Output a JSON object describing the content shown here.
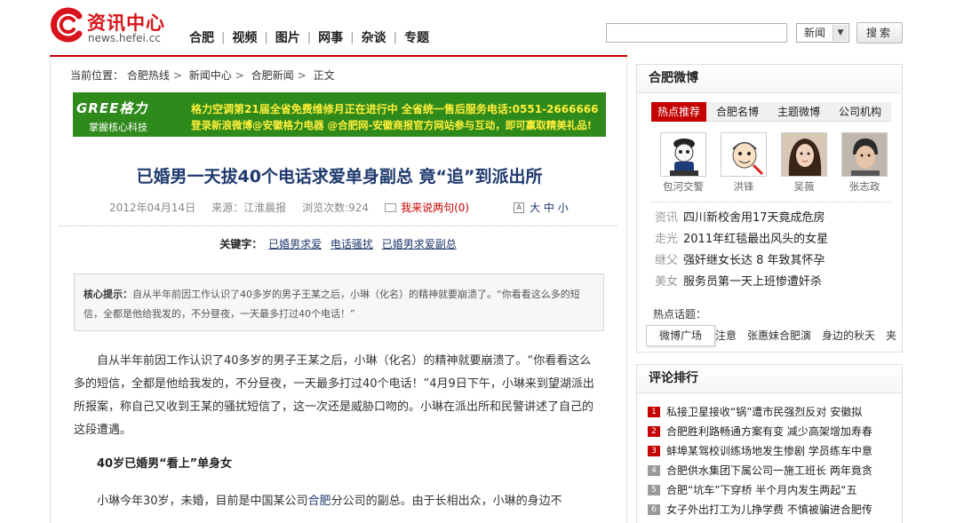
{
  "site": {
    "name": "资讯中心",
    "url": "news.hefei.cc",
    "brand_color": "#d7141b"
  },
  "nav": [
    "合肥",
    "视频",
    "图片",
    "网事",
    "杂谈",
    "专题"
  ],
  "search": {
    "input_value": "",
    "select_value": "新闻",
    "button_label": "搜索"
  },
  "breadcrumb": {
    "label": "当前位置：",
    "items": [
      "合肥热线",
      "新闻中心",
      "合肥新闻",
      "正文"
    ]
  },
  "banner": {
    "brand": "GREE格力",
    "tagline": "掌握核心科技",
    "line1": "格力空调第21届全省免费维修月正在进行中    全省统一售后服务电话:0551-2666666",
    "line2": "登录新浪微博@安徽格力电器 @合肥网-安徽商报官方网站参与互动，即可赢取精美礼品!"
  },
  "article": {
    "title": "已婚男一天拔40个电话求爱单身副总 竟“追”到派出所",
    "date": "2012年04月14日",
    "source": "来源：江淮晨报",
    "views": "浏览次数:924",
    "comment": "我来说两句(0)",
    "font_size_label": "大 中 小",
    "keywords_label": "关键字：",
    "keywords": [
      "已婚男求爱",
      "电话骚扰",
      "已婚男求爱副总"
    ],
    "summary_label": "核心提示：",
    "summary": "自从半年前因工作认识了40多岁的男子王某之后，小琳（化名）的精神就要崩溃了。“你看看这么多的短信，全都是他给我发的，不分昼夜，一天最多打过40个电话！”",
    "para1": "自从半年前因工作认识了40多岁的男子王某之后，小琳（化名）的精神就要崩溃了。“你看看这么多的短信，全都是他给我发的，不分昼夜，一天最多打过40个电话！”4月9日下午，小琳来到望湖派出所报案，称自己又收到王某的骚扰短信了，这一次还是威胁口吻的。小琳在派出所和民警讲述了自己的这段遭遇。",
    "subheading": "40岁已婚男“看上”单身女",
    "para2_before": "小琳今年30岁，未婚，目前是中国某公司",
    "para2_link": "合肥",
    "para2_after": "分公司的副总。由于长相出众，小琳的身边不"
  },
  "weibo": {
    "title": "合肥微博",
    "tabs": [
      "热点推荐",
      "合肥名博",
      "主题微博",
      "公司机构"
    ],
    "active_tab": "热点推荐",
    "avatars": [
      "包河交警",
      "洪锋",
      "吴薇",
      "张志政"
    ],
    "news": [
      {
        "cat": "资讯",
        "text": "四川新校舍用17天竟成危房"
      },
      {
        "cat": "走光",
        "text": "2011年红毯最出风头的女星"
      },
      {
        "cat": "继父",
        "text": "强奸继女长达 8 年致其怀孕"
      },
      {
        "cat": "美女",
        "text": "服务员第一天上班惨遭奸杀"
      }
    ],
    "hot_label": "热点话题：",
    "hot_topics": [
      "注意",
      "张惠妹合肥演",
      "身边的秋天",
      "夹"
    ],
    "square_button": "微博广场"
  },
  "ranking": {
    "title": "评论排行",
    "items": [
      {
        "num": "1",
        "text": "私接卫星接收“锅”遭市民强烈反对 安徽拟"
      },
      {
        "num": "2",
        "text": "合肥胜利路畅通方案有变 减少高架增加寿春"
      },
      {
        "num": "3",
        "text": "蚌埠某驾校训练场地发生惨剧 学员练车中意"
      },
      {
        "num": "4",
        "text": "合肥供水集团下属公司一施工班长 两年竟贪"
      },
      {
        "num": "5",
        "text": "合肥“坑车”下穿桥 半个月内发生两起“五"
      },
      {
        "num": "6",
        "text": "女子外出打工为儿挣学费 不慎被骗进合肥传"
      }
    ]
  },
  "colors": {
    "accent_red": "#c40000",
    "title_blue": "#1f3a6e",
    "banner_green": "#2f8a1c",
    "banner_text": "#ffef3a"
  }
}
